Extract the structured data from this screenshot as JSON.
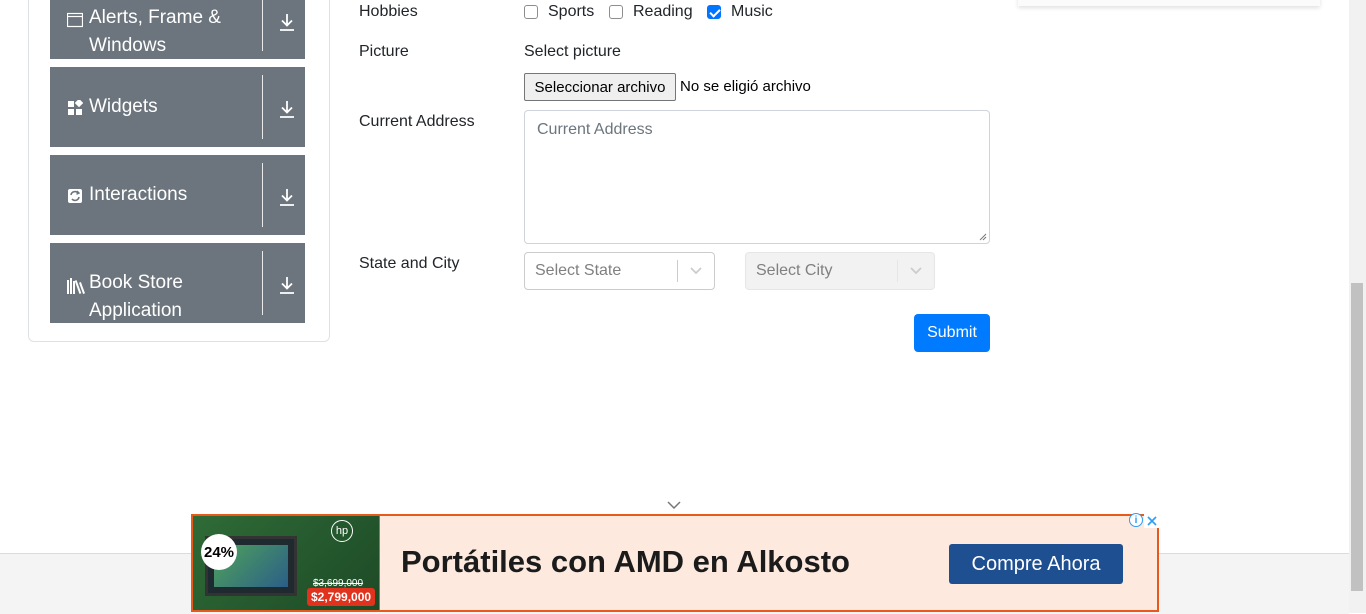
{
  "sidebar": {
    "groups": [
      {
        "label": "Alerts, Frame & Windows",
        "icon": "window-icon"
      },
      {
        "label": "Widgets",
        "icon": "widgets-icon"
      },
      {
        "label": "Interactions",
        "icon": "interactions-icon"
      },
      {
        "label": "Book Store Application",
        "icon": "books-icon"
      }
    ]
  },
  "form": {
    "hobbies_label": "Hobbies",
    "hobbies": [
      {
        "label": "Sports",
        "checked": false
      },
      {
        "label": "Reading",
        "checked": false
      },
      {
        "label": "Music",
        "checked": true
      }
    ],
    "picture_label": "Picture",
    "picture_hint": "Select picture",
    "file_button": "Seleccionar archivo",
    "file_status": "No se eligió archivo",
    "address_label": "Current Address",
    "address_placeholder": "Current Address",
    "state_city_label": "State and City",
    "state_placeholder": "Select State",
    "city_placeholder": "Select City",
    "submit": "Submit"
  },
  "ad": {
    "headline": "Portátiles con AMD en Alkosto",
    "cta": "Compre Ahora",
    "discount": "24%",
    "brand": "hp",
    "old_price": "$3,699,000",
    "new_price": "$2,799,000",
    "info_glyph": "i",
    "accent_color": "#e8591c",
    "cta_color": "#1d4f91"
  },
  "colors": {
    "sidebar_group": "#6c757d",
    "primary": "#007bff",
    "checkbox": "#0075ff"
  }
}
